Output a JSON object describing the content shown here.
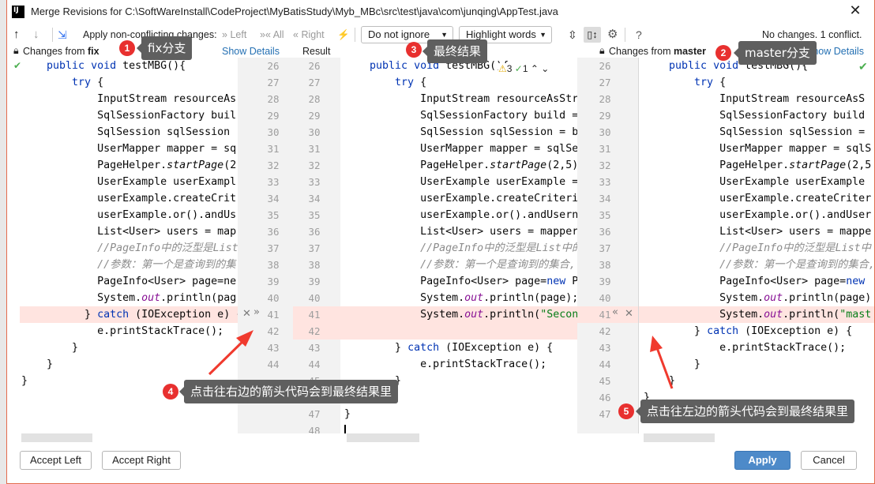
{
  "window": {
    "title": "Merge Revisions for C:\\SoftWareInstall\\CodeProject\\MyBatisStudy\\Myb_MBc\\src\\test\\java\\com\\junqing\\AppTest.java",
    "close_icon": "close-icon"
  },
  "toolbar": {
    "apply_label": "Apply non-conflicting changes:",
    "left": "Left",
    "all": "All",
    "right": "Right",
    "whitespace": "Do not ignore",
    "highlight": "Highlight words",
    "status": "No changes. 1 conflict."
  },
  "header": {
    "left_prefix": "Changes from ",
    "left_branch": "fix",
    "show_details": "Show Details",
    "result": "Result",
    "right_prefix": "Changes from ",
    "right_branch": "master",
    "show_details_right": "Show Details"
  },
  "inspections": {
    "warnings": "3",
    "weak": "1"
  },
  "left": {
    "start": 26,
    "numbers_end": 44,
    "lines": [
      "    public void testMBG(){",
      "        try {",
      "            InputStream resourceAs",
      "            SqlSessionFactory buil",
      "            SqlSession sqlSession ",
      "            UserMapper mapper = sq",
      "            PageHelper.startPage(2",
      "            UserExample userExampl",
      "            userExample.createCrit",
      "            userExample.or().andUs",
      "            List<User> users = map",
      "            //PageInfo中的泛型是List",
      "            //参数：第一个是查询到的集",
      "            PageInfo<User> page=ne",
      "            System.out.println(pag",
      "          } catch (IOException e) {",
      "            e.printStackTrace();",
      "        }",
      "    }",
      "}"
    ]
  },
  "result": {
    "start": 26,
    "numbers_end": 48,
    "lines": [
      "    public void testMBG(){",
      "        try {",
      "            InputStream resourceAsStr",
      "            SqlSessionFactory build =",
      "            SqlSession sqlSession = b",
      "            UserMapper mapper = sqlSe",
      "            PageHelper.startPage(2,5)",
      "            UserExample userExample =",
      "            userExample.createCriteri",
      "            userExample.or().andUsern",
      "            List<User> users = mapper",
      "            //PageInfo中的泛型是List中的",
      "            //参数：第一个是查询到的集合,",
      "            PageInfo<User> page=new P",
      "            System.out.println(page);",
      "            System.out.println(\"Secon",
      "",
      "        } catch (IOException e) {",
      "            e.printStackTrace();",
      "        }",
      "    }",
      "}",
      ""
    ]
  },
  "right": {
    "start": 26,
    "numbers_end": 47,
    "lines": [
      "    public void testMBG(){",
      "        try {",
      "            InputStream resourceAsS",
      "            SqlSessionFactory build",
      "            SqlSession sqlSession =",
      "            UserMapper mapper = sqlS",
      "            PageHelper.startPage(2,5",
      "            UserExample userExample",
      "            userExample.createCriter",
      "            userExample.or().andUser",
      "            List<User> users = mappe",
      "            //PageInfo中的泛型是List中",
      "            //参数：第一个是查询到的集合,",
      "            PageInfo<User> page=new ",
      "            System.out.println(page)",
      "            System.out.println(\"mast",
      "        } catch (IOException e) {",
      "            e.printStackTrace();",
      "        }",
      "    }",
      "}",
      ""
    ]
  },
  "annotations": [
    {
      "n": "1",
      "text": "fix分支"
    },
    {
      "n": "2",
      "text": "master分支"
    },
    {
      "n": "3",
      "text": "最终结果"
    },
    {
      "n": "4",
      "text": "点击往右边的箭头代码会到最终结果里"
    },
    {
      "n": "5",
      "text": "点击往左边的箭头代码会到最终结果里"
    }
  ],
  "footer": {
    "accept_left": "Accept Left",
    "accept_right": "Accept Right",
    "apply": "Apply",
    "cancel": "Cancel"
  },
  "colors": {
    "conflict": "#ffe4e0",
    "accent": "#4d8ac9",
    "annotation": "#e8302f"
  }
}
